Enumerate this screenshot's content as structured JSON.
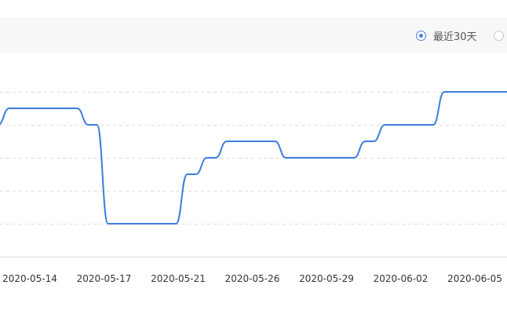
{
  "range_options": [
    {
      "label": "最近30天",
      "checked": true
    },
    {
      "label": "",
      "checked": false
    }
  ],
  "colors": {
    "line": "#3c7ddb",
    "grid": "#dddddd",
    "axis": "#d9d9d9",
    "radio_checked": "#4a7fd4"
  },
  "chart_data": {
    "type": "line",
    "smooth": true,
    "grid": true,
    "grid_style": "dashed",
    "x_tick_labels": [
      "2020-05-14",
      "2020-05-17",
      "2020-05-21",
      "2020-05-26",
      "2020-05-29",
      "2020-06-02",
      "2020-06-05"
    ],
    "x_range": [
      0,
      26
    ],
    "y_range": [
      0,
      5
    ],
    "y_gridlines": [
      1,
      2,
      3,
      4,
      5
    ],
    "series": [
      {
        "points": [
          {
            "x": 0,
            "y": 4.0
          },
          {
            "x": 1,
            "y": 4.5
          },
          {
            "x": 2,
            "y": 4.5
          },
          {
            "x": 3,
            "y": 4.5
          },
          {
            "x": 4,
            "y": 4.5
          },
          {
            "x": 5,
            "y": 4.0
          },
          {
            "x": 6,
            "y": 1.0
          },
          {
            "x": 7,
            "y": 1.0
          },
          {
            "x": 8,
            "y": 1.0
          },
          {
            "x": 9,
            "y": 1.0
          },
          {
            "x": 10,
            "y": 2.5
          },
          {
            "x": 11,
            "y": 3.0
          },
          {
            "x": 12,
            "y": 3.5
          },
          {
            "x": 13,
            "y": 3.5
          },
          {
            "x": 14,
            "y": 3.5
          },
          {
            "x": 15,
            "y": 3.0
          },
          {
            "x": 16,
            "y": 3.0
          },
          {
            "x": 17,
            "y": 3.0
          },
          {
            "x": 18,
            "y": 3.0
          },
          {
            "x": 19,
            "y": 3.5
          },
          {
            "x": 20,
            "y": 4.0
          },
          {
            "x": 21,
            "y": 4.0
          },
          {
            "x": 22,
            "y": 4.0
          },
          {
            "x": 23,
            "y": 5.0
          },
          {
            "x": 24,
            "y": 5.0
          },
          {
            "x": 25,
            "y": 5.0
          },
          {
            "x": 26,
            "y": 5.0
          }
        ]
      }
    ]
  }
}
